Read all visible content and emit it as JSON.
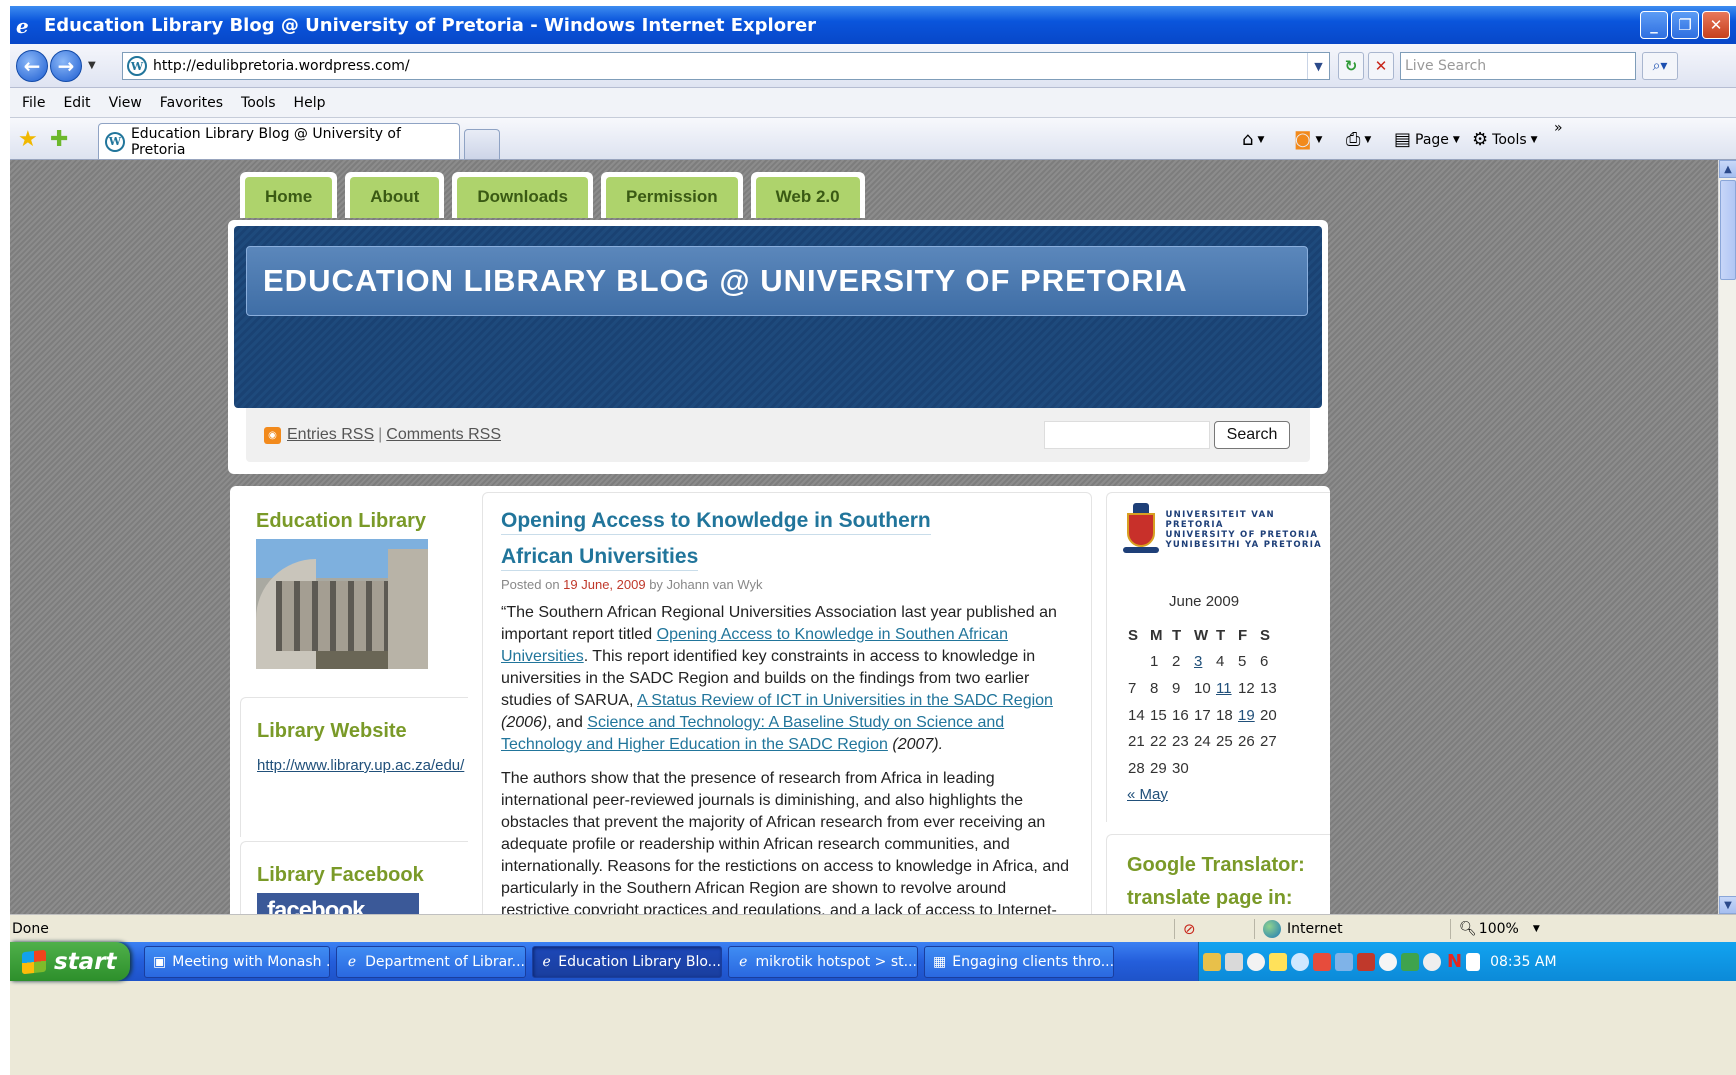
{
  "window": {
    "title": "Education Library Blog @ University of Pretoria - Windows Internet Explorer"
  },
  "address": {
    "url": "http://edulibpretoria.wordpress.com/",
    "search_placeholder": "Live Search"
  },
  "menu": [
    "File",
    "Edit",
    "View",
    "Favorites",
    "Tools",
    "Help"
  ],
  "tab": {
    "title": "Education Library Blog @ University of Pretoria"
  },
  "commandbar": {
    "page_label": "Page",
    "tools_label": "Tools"
  },
  "site": {
    "nav": [
      "Home",
      "About",
      "Downloads",
      "Permission",
      "Web 2.0"
    ],
    "title": "EDUCATION LIBRARY BLOG @ UNIVERSITY OF PRETORIA",
    "rss": {
      "entries": "Entries RSS",
      "sep": "|",
      "comments": "Comments RSS"
    },
    "search_button": "Search"
  },
  "sidebar_left": {
    "education_library_title": "Education Library",
    "website_title": "Library Website",
    "website_link": "http://www.library.up.ac.za/edu/",
    "facebook_title": "Library Facebook",
    "facebook_logo": "facebook"
  },
  "post": {
    "title_line1": "Opening Access to Knowledge in Southern",
    "title_line2": "African Universities",
    "meta_prefix": "Posted on",
    "date": "19 June, 2009",
    "meta_by": "by Johann van Wyk",
    "p1_a": "“The Southern African Regional Universities Association last year published an important report titled",
    "p1_link1": "Opening Access to Knowledge in Southen African Universities",
    "p1_b": ". This report identified key constraints in access to knowledge in universities in the SADC Region and builds on the findings from two earlier studies of  SARUA,",
    "p1_link2": "A Status Review of ICT in Universities in the SADC Region",
    "p1_c": "(2006)",
    "p1_d": ", and",
    "p1_link3": "Science and Technology: A Baseline Study on Science and Technology and Higher Education in the SADC Region",
    "p1_e": "(2007).",
    "p2": "The authors show that the presence of research from Africa in leading international peer-reviewed journals is diminishing, and also highlights the obstacles that prevent the majority of African research from ever receiving an adequate profile or readership within African research communities, and internationally. Reasons for the restictions on access to knowledge in Africa, and particularly in the Southern African Region are shown to revolve around restrictive copyright practices and regulations, and a lack of access to Internet-"
  },
  "sidebar_right": {
    "logo_lines": [
      "UNIVERSITEIT VAN PRETORIA",
      "UNIVERSITY OF PRETORIA",
      "YUNIBESITHI YA PRETORIA"
    ],
    "calendar": {
      "caption": "June 2009",
      "days": [
        "S",
        "M",
        "T",
        "W",
        "T",
        "F",
        "S"
      ],
      "weeks": [
        [
          "",
          "1",
          "2",
          "3",
          "4",
          "5",
          "6"
        ],
        [
          "7",
          "8",
          "9",
          "10",
          "11",
          "12",
          "13"
        ],
        [
          "14",
          "15",
          "16",
          "17",
          "18",
          "19",
          "20"
        ],
        [
          "21",
          "22",
          "23",
          "24",
          "25",
          "26",
          "27"
        ],
        [
          "28",
          "29",
          "30",
          "",
          "",
          "",
          ""
        ]
      ],
      "linked_days": [
        "3",
        "11",
        "19"
      ],
      "prev": "« May"
    },
    "translator_line1": "Google Translator:",
    "translator_line2": "translate page in:"
  },
  "status": {
    "text": "Done",
    "zone": "Internet",
    "zoom": "100%"
  },
  "taskbar": {
    "start": "start",
    "tasks": [
      "Meeting with Monash ...",
      "Department of Librar...",
      "Education Library Blo...",
      "mikrotik hotspot > st...",
      "Engaging clients thro..."
    ],
    "active_task": 2,
    "clock": "08:35 AM"
  }
}
